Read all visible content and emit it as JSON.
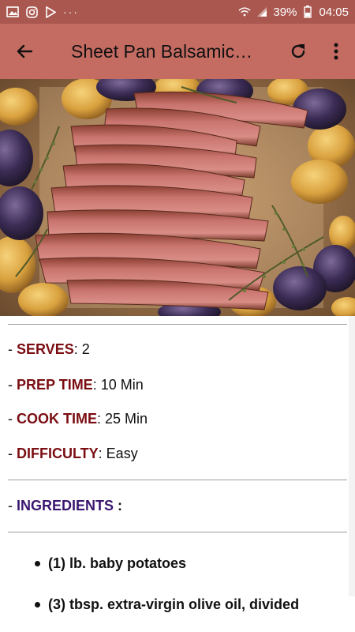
{
  "status_bar": {
    "battery": "39%",
    "time": "04:05",
    "more": "···",
    "icons": [
      "image-icon",
      "instagram-icon",
      "play-store-icon",
      "wifi-icon",
      "signal-icon",
      "battery-icon"
    ]
  },
  "app_bar": {
    "title": "Sheet Pan Balsamic…",
    "accent": "#c46b62",
    "status_color": "#a9574f",
    "icons": [
      "back-arrow-icon",
      "refresh-icon",
      "more-vert-icon"
    ]
  },
  "details": [
    {
      "label": "SERVES",
      "value": "2"
    },
    {
      "label": "PREP TIME",
      "value": "10 Min"
    },
    {
      "label": "COOK TIME",
      "value": "25 Min"
    },
    {
      "label": "DIFFICULTY",
      "value": "Easy"
    }
  ],
  "ingredients_header": "INGREDIENTS",
  "ingredients": [
    "(1) lb. baby potatoes",
    "(3) tbsp. extra-virgin olive oil, divided"
  ],
  "colors": {
    "label_red": "#7a0d12",
    "label_purple": "#3a1670"
  }
}
